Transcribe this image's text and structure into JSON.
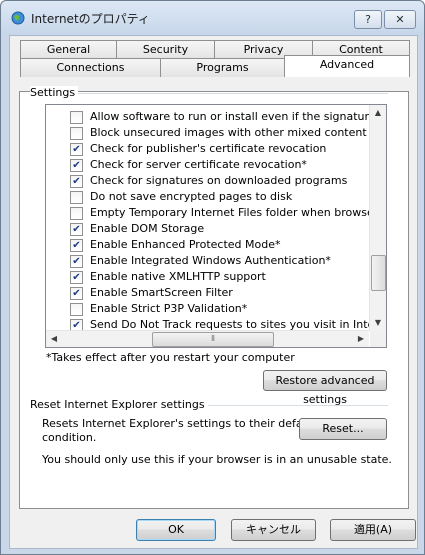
{
  "window": {
    "title": "Internetのプロパティ",
    "help_label": "?",
    "close_label": "✕"
  },
  "tabs_row1": [
    "General",
    "Security",
    "Privacy",
    "Content"
  ],
  "tabs_row2": [
    "Connections",
    "Programs",
    "Advanced"
  ],
  "settings": {
    "group_label": "Settings",
    "items": [
      {
        "label": "Allow software to run or install even if the signature is inva",
        "checked": false
      },
      {
        "label": "Block unsecured images with other mixed content",
        "checked": false
      },
      {
        "label": "Check for publisher's certificate revocation",
        "checked": true
      },
      {
        "label": "Check for server certificate revocation*",
        "checked": true
      },
      {
        "label": "Check for signatures on downloaded programs",
        "checked": true
      },
      {
        "label": "Do not save encrypted pages to disk",
        "checked": false
      },
      {
        "label": "Empty Temporary Internet Files folder when browser is clo",
        "checked": false
      },
      {
        "label": "Enable DOM Storage",
        "checked": true
      },
      {
        "label": "Enable Enhanced Protected Mode*",
        "checked": true
      },
      {
        "label": "Enable Integrated Windows Authentication*",
        "checked": true
      },
      {
        "label": "Enable native XMLHTTP support",
        "checked": true
      },
      {
        "label": "Enable SmartScreen Filter",
        "checked": true
      },
      {
        "label": "Enable Strict P3P Validation*",
        "checked": false
      },
      {
        "label": "Send Do Not Track requests to sites you visit in Internet E",
        "checked": true
      }
    ],
    "note": "*Takes effect after you restart your computer",
    "restore_label": "Restore advanced settings"
  },
  "reset": {
    "group_label": "Reset Internet Explorer settings",
    "desc_line1": "Resets Internet Explorer's settings to their default",
    "desc_line2": "condition.",
    "button_label": "Reset...",
    "warning": "You should only use this if your browser is in an unusable state."
  },
  "footer": {
    "ok_label": "OK",
    "cancel_label": "キャンセル",
    "apply_label": "適用(A)"
  }
}
